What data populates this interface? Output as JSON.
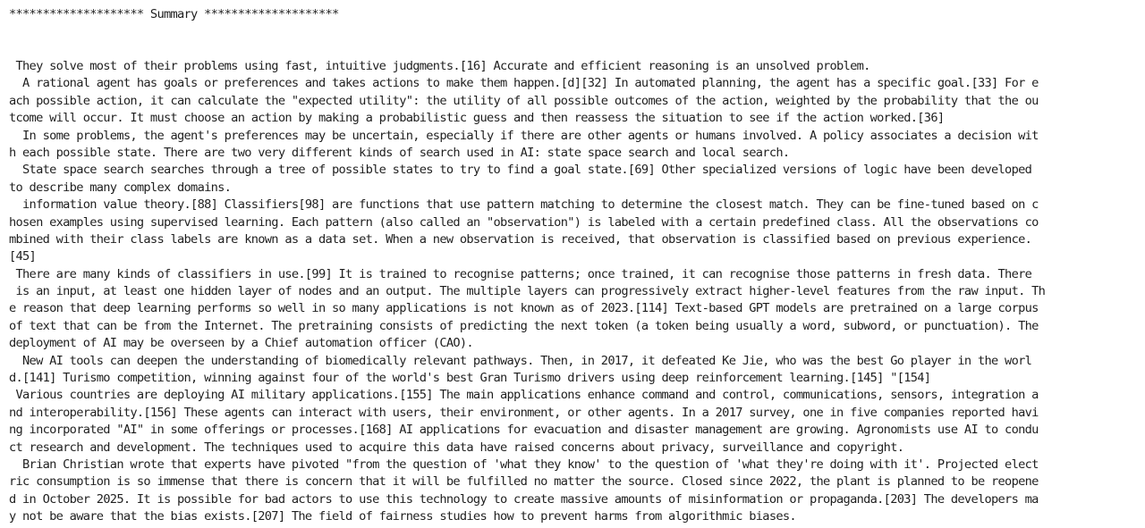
{
  "header": {
    "title": "******************** Summary ********************"
  },
  "lines": [
    " They solve most of their problems using fast, intuitive judgments.[16] Accurate and efficient reasoning is an unsolved problem.",
    "  A rational agent has goals or preferences and takes actions to make them happen.[d][32] In automated planning, the agent has a specific goal.[33] For e",
    "ach possible action, it can calculate the \"expected utility\": the utility of all possible outcomes of the action, weighted by the probability that the ou",
    "tcome will occur. It must choose an action by making a probabilistic guess and then reassess the situation to see if the action worked.[36]",
    "  In some problems, the agent's preferences may be uncertain, especially if there are other agents or humans involved. A policy associates a decision wit",
    "h each possible state. There are two very different kinds of search used in AI: state space search and local search.",
    "  State space search searches through a tree of possible states to try to find a goal state.[69] Other specialized versions of logic have been developed",
    "to describe many complex domains.",
    "  information value theory.[88] Classifiers[98] are functions that use pattern matching to determine the closest match. They can be fine-tuned based on c",
    "hosen examples using supervised learning. Each pattern (also called an \"observation\") is labeled with a certain predefined class. All the observations co",
    "mbined with their class labels are known as a data set. When a new observation is received, that observation is classified based on previous experience.",
    "[45]",
    " There are many kinds of classifiers in use.[99] It is trained to recognise patterns; once trained, it can recognise those patterns in fresh data. There",
    " is an input, at least one hidden layer of nodes and an output. The multiple layers can progressively extract higher-level features from the raw input. Th",
    "e reason that deep learning performs so well in so many applications is not known as of 2023.[114] Text-based GPT models are pretrained on a large corpus",
    "of text that can be from the Internet. The pretraining consists of predicting the next token (a token being usually a word, subword, or punctuation). The",
    "deployment of AI may be overseen by a Chief automation officer (CAO).",
    "  New AI tools can deepen the understanding of biomedically relevant pathways. Then, in 2017, it defeated Ke Jie, who was the best Go player in the worl",
    "d.[141] Turismo competition, winning against four of the world's best Gran Turismo drivers using deep reinforcement learning.[145] \"[154]",
    " Various countries are deploying AI military applications.[155] The main applications enhance command and control, communications, sensors, integration a",
    "nd interoperability.[156] These agents can interact with users, their environment, or other agents. In a 2017 survey, one in five companies reported havi",
    "ng incorporated \"AI\" in some offerings or processes.[168] AI applications for evacuation and disaster management are growing. Agronomists use AI to condu",
    "ct research and development. The techniques used to acquire this data have raised concerns about privacy, surveillance and copyright.",
    "  Brian Christian wrote that experts have pivoted \"from the question of 'what they know' to the question of 'what they're doing with it'. Projected elect",
    "ric consumption is so immense that there is concern that it will be fulfilled no matter the source. Closed since 2022, the plant is planned to be reopene",
    "d in October 2025. It is possible for bad actors to use this technology to create massive amounts of misinformation or propaganda.[203] The developers ma",
    "y not be aware that the bias exists.[207] The field of fairness studies how to prevent harms from algorithmic biases."
  ]
}
